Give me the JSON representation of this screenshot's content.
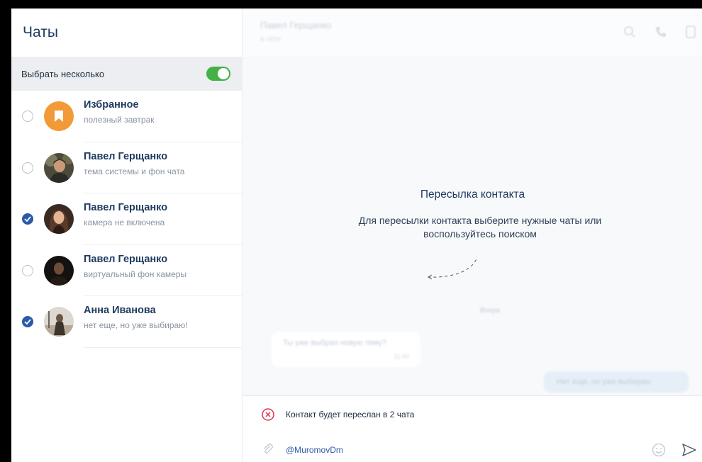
{
  "sidebar": {
    "title": "Чаты",
    "multi_select": {
      "label": "Выбрать несколько",
      "enabled": true
    },
    "chats": [
      {
        "name": "Избранное",
        "preview": "полезный завтрак",
        "selected": false,
        "avatar": "bookmark-icon"
      },
      {
        "name": "Павел Герщанко",
        "preview": "тема системы и фон чата",
        "selected": false,
        "avatar": "photo"
      },
      {
        "name": "Павел Герщанко",
        "preview": "камера не включена",
        "selected": true,
        "avatar": "photo"
      },
      {
        "name": "Павел Герщанко",
        "preview": "виртуальный фон камеры",
        "selected": false,
        "avatar": "photo"
      },
      {
        "name": "Анна Иванова",
        "preview": "нет еще, но уже выбираю!",
        "selected": true,
        "avatar": "photo"
      }
    ]
  },
  "conversation": {
    "header_name": "Павел Герщанко",
    "header_status": "в сети",
    "date_separator": "Вчера",
    "incoming_message": {
      "text": "Ты уже выбрал новую тему?",
      "time": "11:40"
    },
    "outgoing_message": {
      "text": "Нет еще, но уже выбираю"
    }
  },
  "forward": {
    "title": "Пересылка контакта",
    "description": "Для пересылки контакта выберите нужные чаты или воспользуйтесь поиском",
    "note": "Контакт будет переслан в 2 чата"
  },
  "composer": {
    "value": "@MuromovDm"
  },
  "colors": {
    "accent": "#2b5aa7",
    "toggle_on": "#45b045",
    "favorites": "#f29a38",
    "cancel": "#e0344f"
  }
}
